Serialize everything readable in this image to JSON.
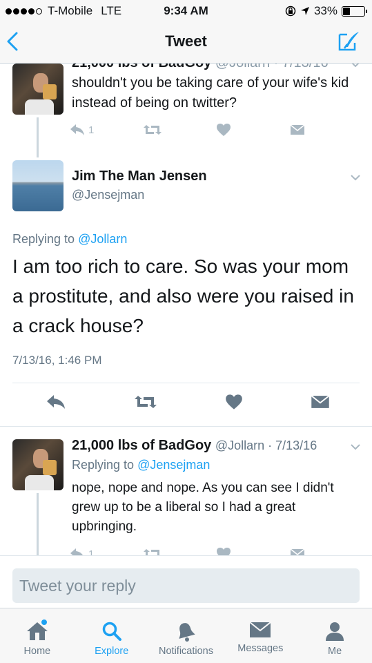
{
  "status": {
    "carrier": "T-Mobile",
    "network": "LTE",
    "time": "9:34 AM",
    "battery": "33%"
  },
  "nav": {
    "title": "Tweet",
    "back_icon": "chevron-left-icon",
    "compose_icon": "compose-icon"
  },
  "tweet_prev": {
    "name": "21,000 lbs of BadGoy",
    "handle_date": "@Jollarn · 7/13/16",
    "text": "shouldn't you be taking care of your wife's kid instead of being on twitter?",
    "reply_count": "1"
  },
  "tweet_main": {
    "name": "Jim The Man Jensen",
    "handle": "@Jensejman",
    "replying_prefix": "Replying to",
    "replying_to": "@Jollarn",
    "text": "I am too rich to care. So was your mom a prostitute, and also were you raised in a crack house?",
    "date": "7/13/16, 1:46 PM"
  },
  "tweet_reply": {
    "name": "21,000 lbs of BadGoy",
    "meta": "@Jollarn · 7/13/16",
    "replying_prefix": "Replying to",
    "replying_to": "@Jensejman",
    "text": "nope, nope and nope. As you can see I didn't grew up to be a liberal so I had a great upbringing.",
    "reply_count": "1"
  },
  "reply_box": {
    "placeholder": "Tweet your reply"
  },
  "tabs": [
    {
      "label": "Home",
      "icon": "home-icon"
    },
    {
      "label": "Explore",
      "icon": "search-icon"
    },
    {
      "label": "Notifications",
      "icon": "bell-icon"
    },
    {
      "label": "Messages",
      "icon": "envelope-icon"
    },
    {
      "label": "Me",
      "icon": "person-icon"
    }
  ],
  "colors": {
    "accent": "#1da1f2",
    "text": "#14171a",
    "muted": "#657786",
    "icon_gray": "#aab8c2"
  }
}
